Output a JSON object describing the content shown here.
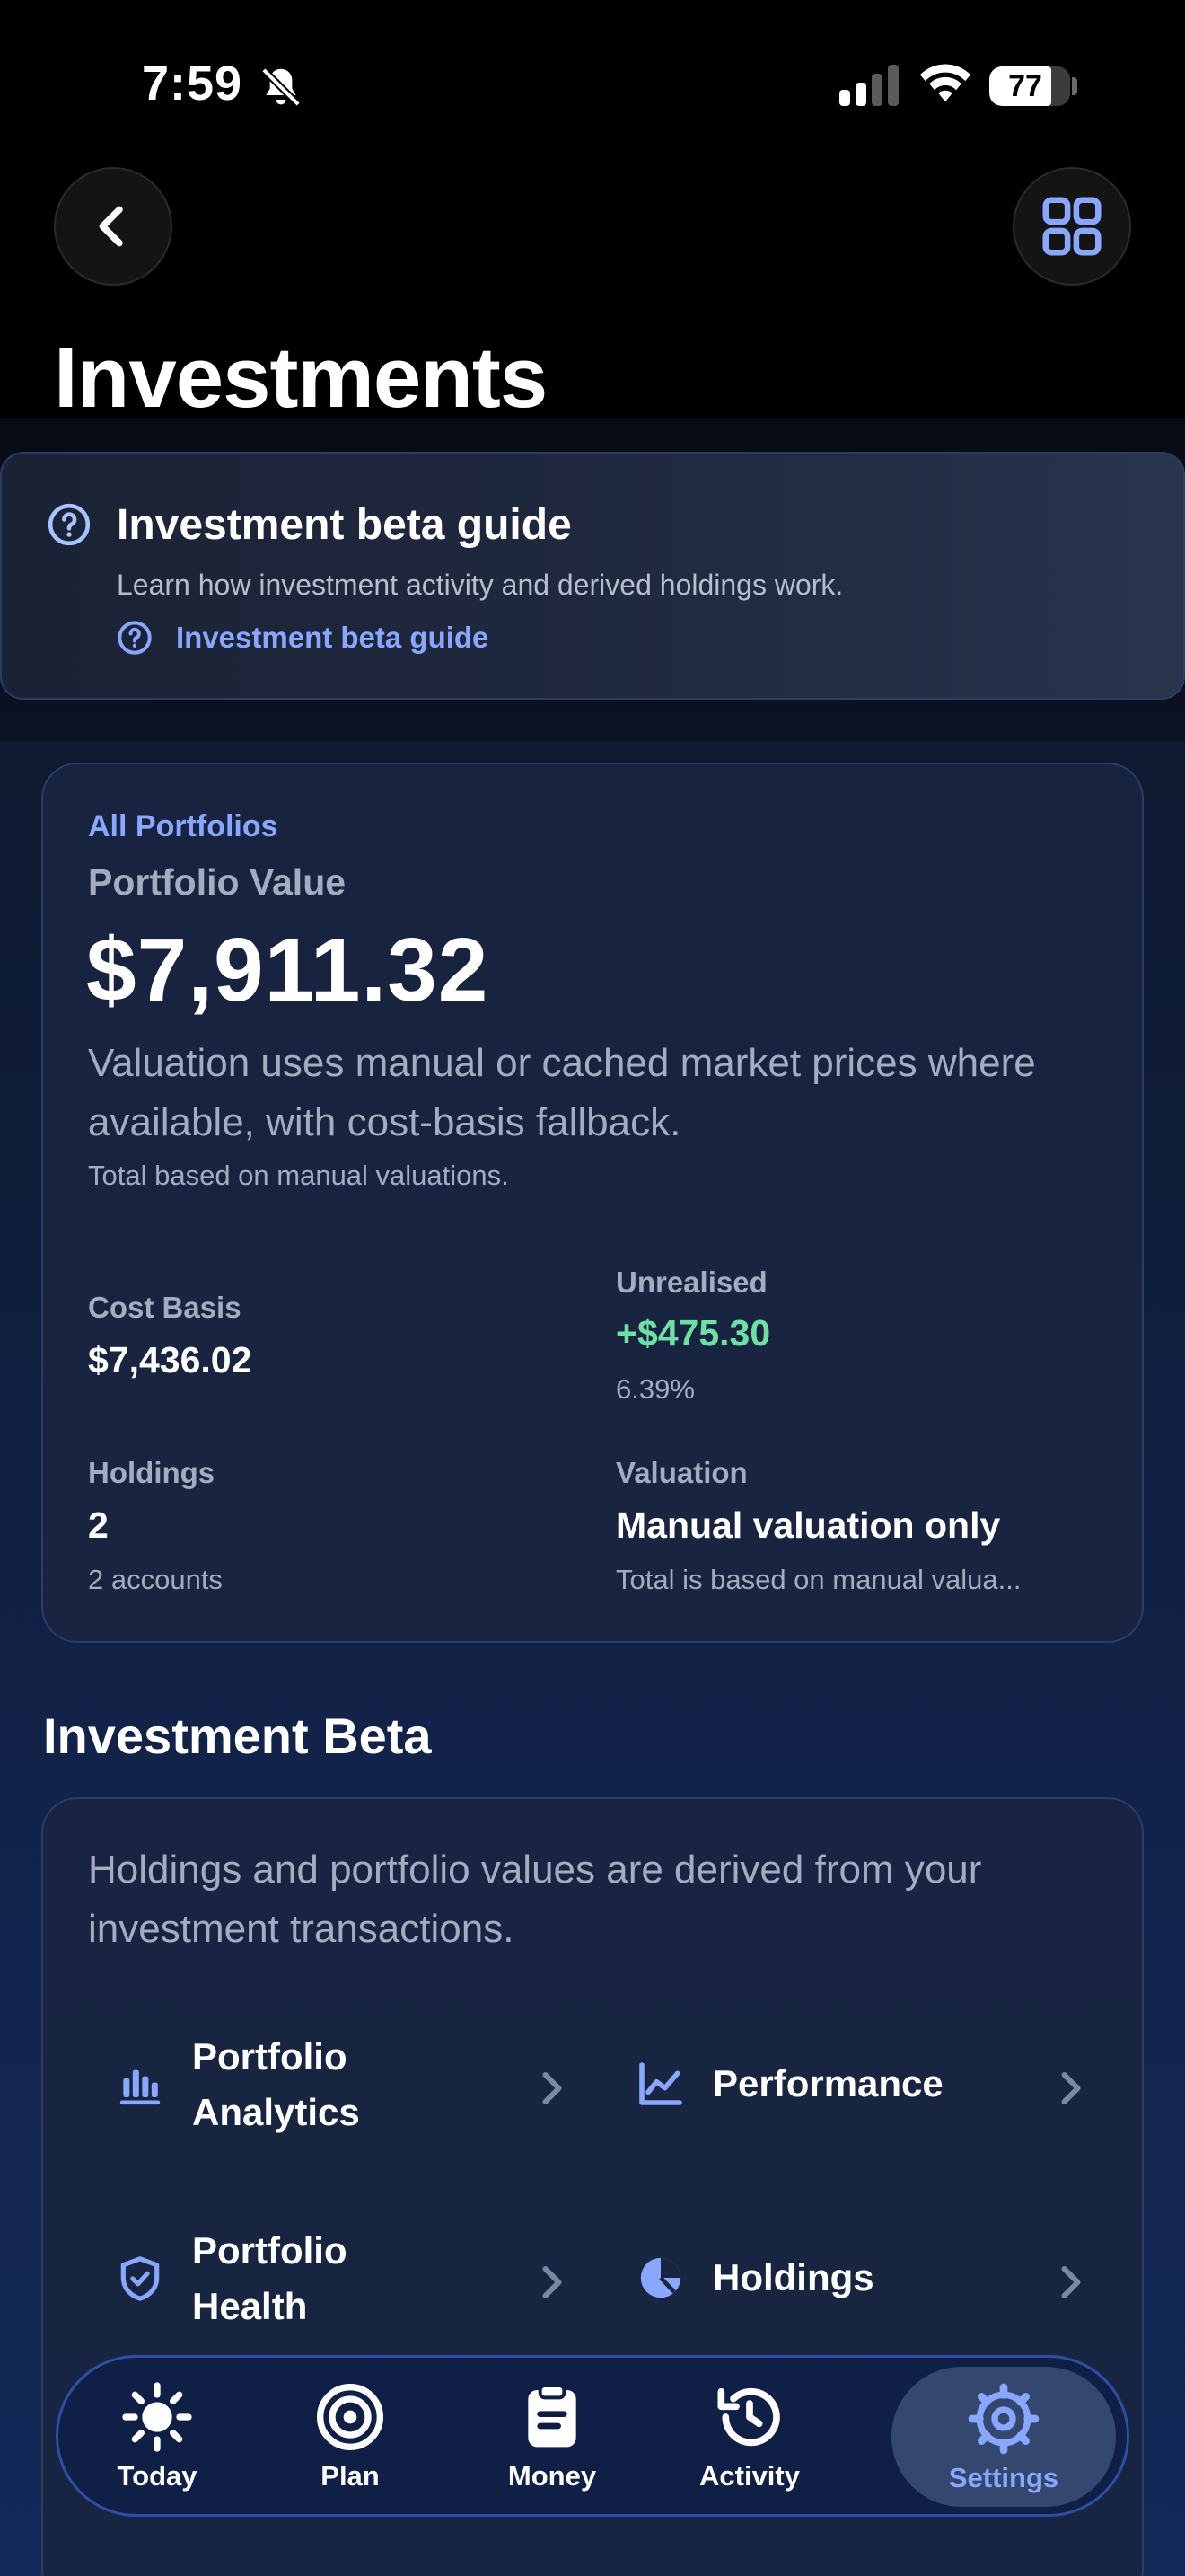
{
  "status_bar": {
    "time": "7:59",
    "battery": "77"
  },
  "header": {
    "title": "Investments"
  },
  "guide": {
    "title": "Investment beta guide",
    "description": "Learn how investment activity and derived holdings work.",
    "link_label": "Investment beta guide"
  },
  "portfolio": {
    "scope": "All Portfolios",
    "value_label": "Portfolio Value",
    "value": "$7,911.32",
    "description": "Valuation uses manual or cached market prices where available, with cost-basis fallback.",
    "note": "Total based on manual valuations.",
    "cost_basis_label": "Cost Basis",
    "cost_basis_value": "$7,436.02",
    "unrealised_label": "Unrealised",
    "unrealised_value": "+$475.30",
    "unrealised_pct": "6.39%",
    "holdings_label": "Holdings",
    "holdings_value": "2",
    "holdings_sub": "2 accounts",
    "valuation_label": "Valuation",
    "valuation_value": "Manual valuation only",
    "valuation_sub": "Total is based on manual valua..."
  },
  "beta": {
    "section_title": "Investment Beta",
    "description": "Holdings and portfolio values are derived from your investment transactions.",
    "tiles": [
      {
        "label_line1": "Portfolio",
        "label_line2": "Analytics",
        "icon": "bar-chart-icon"
      },
      {
        "label_line1": "Performance",
        "label_line2": "",
        "icon": "line-chart-icon"
      },
      {
        "label_line1": "Portfolio",
        "label_line2": "Health",
        "icon": "shield-check-icon"
      },
      {
        "label_line1": "Holdings",
        "label_line2": "",
        "icon": "pie-chart-icon"
      }
    ]
  },
  "tabbar": {
    "tabs": [
      {
        "label": "Today",
        "icon": "sun-icon"
      },
      {
        "label": "Plan",
        "icon": "target-icon"
      },
      {
        "label": "Money",
        "icon": "clipboard-icon"
      },
      {
        "label": "Activity",
        "icon": "history-icon"
      },
      {
        "label": "Settings",
        "icon": "gear-icon"
      }
    ],
    "active": "Settings"
  },
  "colors": {
    "accent": "#8aa7ff",
    "positive": "#6fe0a4",
    "card": "#192540"
  }
}
